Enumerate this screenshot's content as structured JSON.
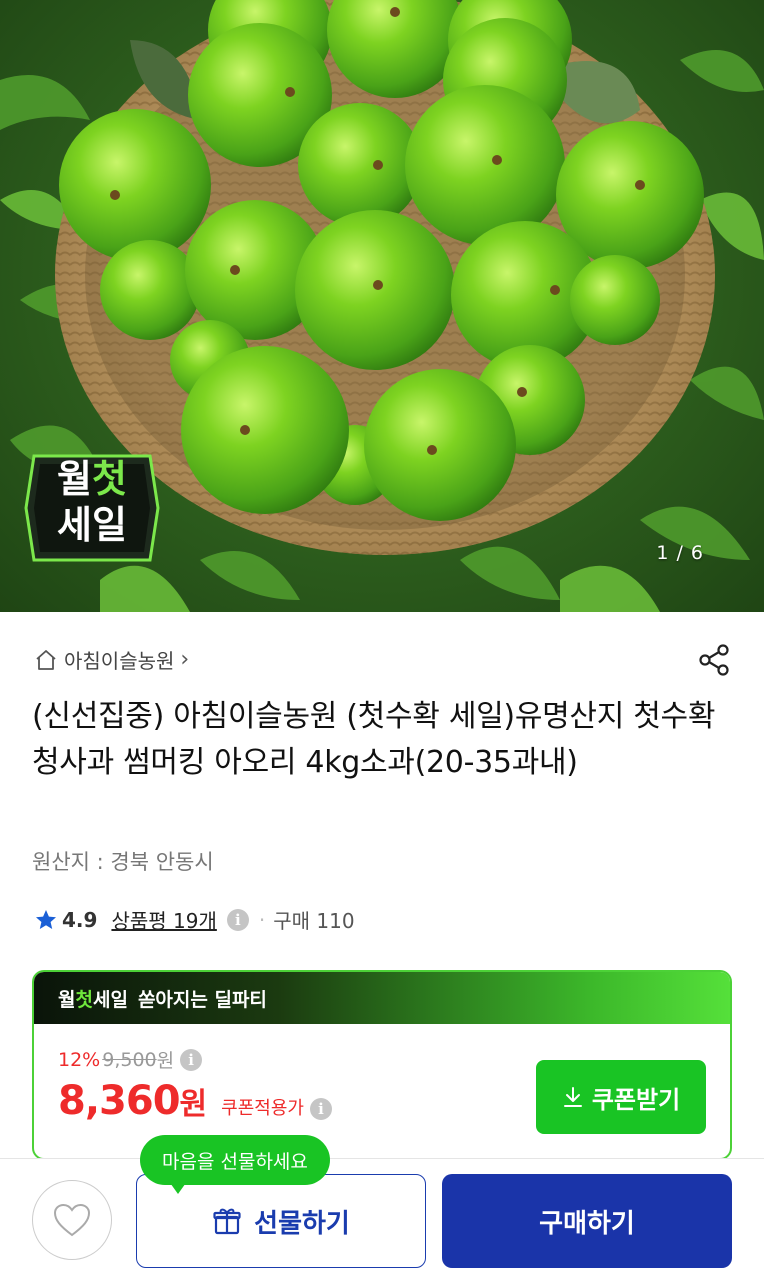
{
  "hero": {
    "badge_line1_a": "월",
    "badge_line1_b": "첫",
    "badge_line2": "세일",
    "page_indicator": "1 / 6"
  },
  "store": {
    "name": "아침이슬농원",
    "chevron": "›"
  },
  "product": {
    "title": "(신선집중) 아침이슬농원 (첫수확 세일)유명산지 첫수확 청사과 썸머킹 아오리 4kg소과(20-35과내)",
    "origin": "원산지 : 경북 안동시",
    "rating": "4.9",
    "review_label": "상품평 19개",
    "purchase_label": "구매 110"
  },
  "deal": {
    "header_a": "월",
    "header_b": "첫",
    "header_c": "세일",
    "header_tagline": "쏟아지는 딜파티",
    "discount_rate": "12%",
    "original_price": "9,500",
    "original_unit": "원",
    "price": "8,360",
    "price_unit": "원",
    "coupon_price_label": "쿠폰적용가",
    "coupon_button": "쿠폰받기"
  },
  "actions": {
    "tooltip": "마음을 선물하세요",
    "gift_button": "선물하기",
    "buy_button": "구매하기"
  },
  "colors": {
    "accent_green": "#19c424",
    "price_red": "#ee2b2b",
    "brand_blue": "#1a34a9"
  },
  "icons": [
    "home-icon",
    "share-icon",
    "star-icon",
    "info-icon",
    "download-icon",
    "heart-icon",
    "gift-icon"
  ]
}
